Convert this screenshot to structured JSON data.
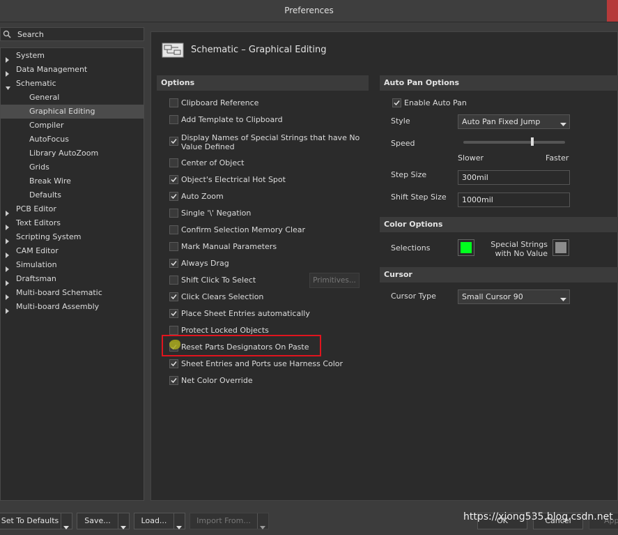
{
  "window": {
    "title": "Preferences"
  },
  "search": {
    "label": "Search"
  },
  "tree": [
    {
      "label": "System",
      "expandable": true,
      "level": 0
    },
    {
      "label": "Data Management",
      "expandable": true,
      "level": 0
    },
    {
      "label": "Schematic",
      "expandable": true,
      "expanded": true,
      "level": 0
    },
    {
      "label": "General",
      "level": 1
    },
    {
      "label": "Graphical Editing",
      "level": 1,
      "selected": true
    },
    {
      "label": "Compiler",
      "level": 1
    },
    {
      "label": "AutoFocus",
      "level": 1
    },
    {
      "label": "Library AutoZoom",
      "level": 1
    },
    {
      "label": "Grids",
      "level": 1
    },
    {
      "label": "Break Wire",
      "level": 1
    },
    {
      "label": "Defaults",
      "level": 1
    },
    {
      "label": "PCB Editor",
      "expandable": true,
      "level": 0
    },
    {
      "label": "Text Editors",
      "expandable": true,
      "level": 0
    },
    {
      "label": "Scripting System",
      "expandable": true,
      "level": 0
    },
    {
      "label": "CAM Editor",
      "expandable": true,
      "level": 0
    },
    {
      "label": "Simulation",
      "expandable": true,
      "level": 0
    },
    {
      "label": "Draftsman",
      "expandable": true,
      "level": 0
    },
    {
      "label": "Multi-board Schematic",
      "expandable": true,
      "level": 0
    },
    {
      "label": "Multi-board Assembly",
      "expandable": true,
      "level": 0
    }
  ],
  "page": {
    "title": "Schematic – Graphical Editing"
  },
  "options": {
    "header": "Options",
    "items": [
      {
        "label": "Clipboard Reference",
        "checked": false
      },
      {
        "label": "Add Template to Clipboard",
        "checked": false
      },
      {
        "label": "Display Names of Special Strings that have No Value Defined",
        "checked": true
      },
      {
        "label": "Center of Object",
        "checked": false
      },
      {
        "label": "Object's Electrical Hot Spot",
        "checked": true
      },
      {
        "label": "Auto Zoom",
        "checked": true
      },
      {
        "label": "Single '\\' Negation",
        "checked": false
      },
      {
        "label": "Confirm Selection Memory Clear",
        "checked": false
      },
      {
        "label": "Mark Manual Parameters",
        "checked": false
      },
      {
        "label": "Always Drag",
        "checked": true
      },
      {
        "label": "Shift Click To Select",
        "checked": false
      },
      {
        "label": "Click Clears Selection",
        "checked": true
      },
      {
        "label": "Place Sheet Entries automatically",
        "checked": true
      },
      {
        "label": "Protect Locked Objects",
        "checked": false
      },
      {
        "label": "Reset Parts Designators On Paste",
        "checked": true
      },
      {
        "label": "Sheet Entries and Ports use Harness Color",
        "checked": true
      },
      {
        "label": "Net Color Override",
        "checked": true
      }
    ],
    "primitives_button": "Primitives..."
  },
  "auto_pan": {
    "header": "Auto Pan Options",
    "enable_label": "Enable Auto Pan",
    "enable_checked": true,
    "style_label": "Style",
    "style_value": "Auto Pan Fixed Jump",
    "speed_label": "Speed",
    "speed_level": 0.68,
    "slower_label": "Slower",
    "faster_label": "Faster",
    "step_size_label": "Step Size",
    "step_size_value": "300mil",
    "shift_step_label": "Shift Step Size",
    "shift_step_value": "1000mil"
  },
  "color_options": {
    "header": "Color Options",
    "selections_label": "Selections",
    "selections_color": "#00ff1e",
    "special_label_1": "Special Strings",
    "special_label_2": "with No Value",
    "special_color": "#8c8c8c"
  },
  "cursor": {
    "header": "Cursor",
    "type_label": "Cursor Type",
    "type_value": "Small Cursor 90"
  },
  "bottom": {
    "set_defaults": "Set To Defaults",
    "save": "Save...",
    "load": "Load...",
    "import_from": "Import From...",
    "ok": "OK",
    "cancel": "Cancel",
    "apply": "Apply"
  },
  "watermark": "https://xiong535.blog.csdn.net",
  "colors": {
    "highlight": "#e0141e",
    "accent": "#4b4b4b"
  }
}
